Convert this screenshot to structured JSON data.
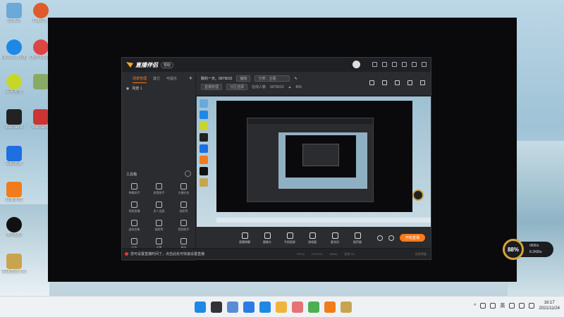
{
  "desktop": {
    "icons": [
      {
        "label": "回收站",
        "color": "#6aa9d8"
      },
      {
        "label": "Microsoft Edge",
        "color": "#1e88e5"
      },
      {
        "label": "天天星盟",
        "color": "#c6d62b"
      },
      {
        "label": "WeGame",
        "color": "#222222"
      },
      {
        "label": "电脑管家",
        "color": "#1e6fe0"
      },
      {
        "label": "直播伴侣",
        "color": "#f07c1e"
      },
      {
        "label": "腾讯QQ",
        "color": "#111111"
      },
      {
        "label": "英雄联盟 WeGame版",
        "color": "#c8a450"
      }
    ],
    "icons_col2": [
      {
        "label": "PlayTo...",
        "color": "#e05a2a"
      },
      {
        "label": "OBS Studio",
        "color": "#d44"
      },
      {
        "label": "",
        "color": "#8a6"
      },
      {
        "label": "WeGame",
        "color": "#c33"
      }
    ]
  },
  "app": {
    "name": "直播伴侣",
    "badge": "帮助",
    "left_tabs": [
      "场景管理",
      "其它",
      "可提示"
    ],
    "scene_label": "场景 1",
    "tools_title": "工具箱",
    "tools": [
      "弹幕助手",
      "房管助手",
      "主播任务",
      "视频直播",
      "多人连麦",
      "抽奖等",
      "虚拟形象",
      "福袋等",
      "营销助手",
      "红包",
      "设置",
      "更多"
    ],
    "title": "致的一天。9979015",
    "title_tag": "编辑",
    "category": "分类：主题",
    "tag2": "直播管理",
    "tag3": "分区选择",
    "viewers_label": "在线人数",
    "viewers": "9979015",
    "likes": "850",
    "controls": [
      "直播弹幕",
      "摄像头",
      "手机投屏",
      "游戏窗",
      "麦克风",
      "扬声器"
    ],
    "start_button": "开始直播",
    "status_message": "您可设置直播时间了，点击此处可快速设置直播",
    "stats": [
      "FPS:0",
      "CPU:0%",
      "0KB/s",
      "丢帧 0%"
    ],
    "exp": "经验等级"
  },
  "gauge": {
    "value": "88%",
    "up": "0KB/s",
    "down": "8.2KB/s"
  },
  "taskbar": {
    "apps": [
      "#1e88e5",
      "#333333",
      "#5b8bd6",
      "#2c7be5",
      "#1e88e5",
      "#f0b43c",
      "#e57373",
      "#4caf50",
      "#f07c1e",
      "#c8a450"
    ],
    "ime": "英",
    "time": "16:17",
    "date": "2021/11/24"
  }
}
